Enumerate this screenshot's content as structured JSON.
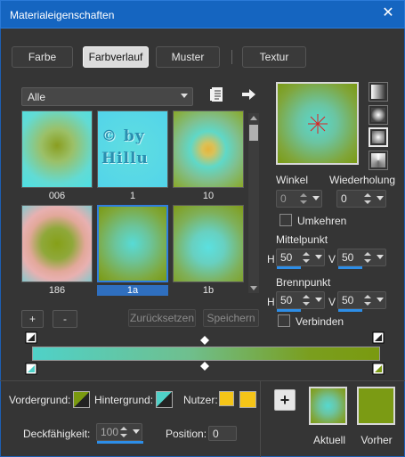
{
  "window": {
    "title": "Materialeigenschaften",
    "close_glyph": "✕"
  },
  "tabs": [
    {
      "label": "Farbe",
      "active": false
    },
    {
      "label": "Farbverlauf",
      "active": true
    },
    {
      "label": "Muster",
      "active": false
    },
    {
      "label": "Textur",
      "active": false
    }
  ],
  "category": {
    "selected": "Alle"
  },
  "gradients": [
    {
      "name": "006",
      "style": "radial-gradient(circle at 50% 45%,#8a9e20 0%,#9bc068 30%,#62dbd4 70%,#4ee0e4 100%)"
    },
    {
      "name": "1",
      "style": "radial-gradient(circle at 50% 50%,#5fdde0 0%,#58d8e6 60%,#52d4ea 100%)",
      "watermark": "© by Hillu"
    },
    {
      "name": "10",
      "style": "radial-gradient(circle at 50% 50%,#e6b43a 0%,#d9c25a 12%,#5fd8c8 35%,#80c090 60%,#8aa828 100%)"
    },
    {
      "name": "186",
      "style": "radial-gradient(circle at 50% 50%,#86a018 0%,#8fa83a 30%,#e2a89a 55%,#e8b0b0 70%,#86c8cc 100%)"
    },
    {
      "name": "1a",
      "style": "radial-gradient(circle at 50% 50%,#57dbd6 0%,#6cc49a 35%,#7fa83c 75%,#7a9a14 100%)"
    },
    {
      "name": "1b",
      "style": "radial-gradient(circle at 50% 55%,#5be0e0 0%,#68d0c0 30%,#7fb05a 65%,#809c18 100%)"
    }
  ],
  "selected_gradient": "1a",
  "buttons": {
    "add": "+",
    "remove": "-",
    "reset": "Zurücksetzen",
    "save": "Speichern"
  },
  "fields": {
    "angle": {
      "label": "Winkel",
      "value": "0"
    },
    "repeat": {
      "label": "Wiederholung",
      "value": "0"
    },
    "invert": {
      "label": "Umkehren",
      "checked": false
    },
    "center": {
      "label": "Mittelpunkt",
      "h_label": "H",
      "h": "50",
      "v_label": "V",
      "v": "50"
    },
    "focus": {
      "label": "Brennpunkt",
      "h_label": "H",
      "h": "50",
      "v_label": "V",
      "v": "50"
    },
    "link": {
      "label": "Verbinden",
      "checked": false
    }
  },
  "footer": {
    "fg_label": "Vordergrund:",
    "bg_label": "Hintergrund:",
    "user_label": "Nutzer:",
    "opacity_label": "Deckfähigkeit:",
    "opacity": "100",
    "position_label": "Position:",
    "position": "0",
    "add_label": "+",
    "current_label": "Aktuell",
    "previous_label": "Vorher"
  },
  "colors": {
    "accent": "#2f7fe0",
    "title_bar": "#1565c0",
    "stop_teal": "#4fd1c8",
    "stop_olive": "#7a9a10",
    "user_yellow": "#f5c518"
  },
  "icons": [
    "document-icon",
    "arrow-right-icon",
    "crosshair-icon",
    "linear-style-icon",
    "rectangular-style-icon",
    "sunburst-style-icon",
    "radial-style-icon",
    "stop-marker-icon",
    "midpoint-diamond-icon"
  ]
}
